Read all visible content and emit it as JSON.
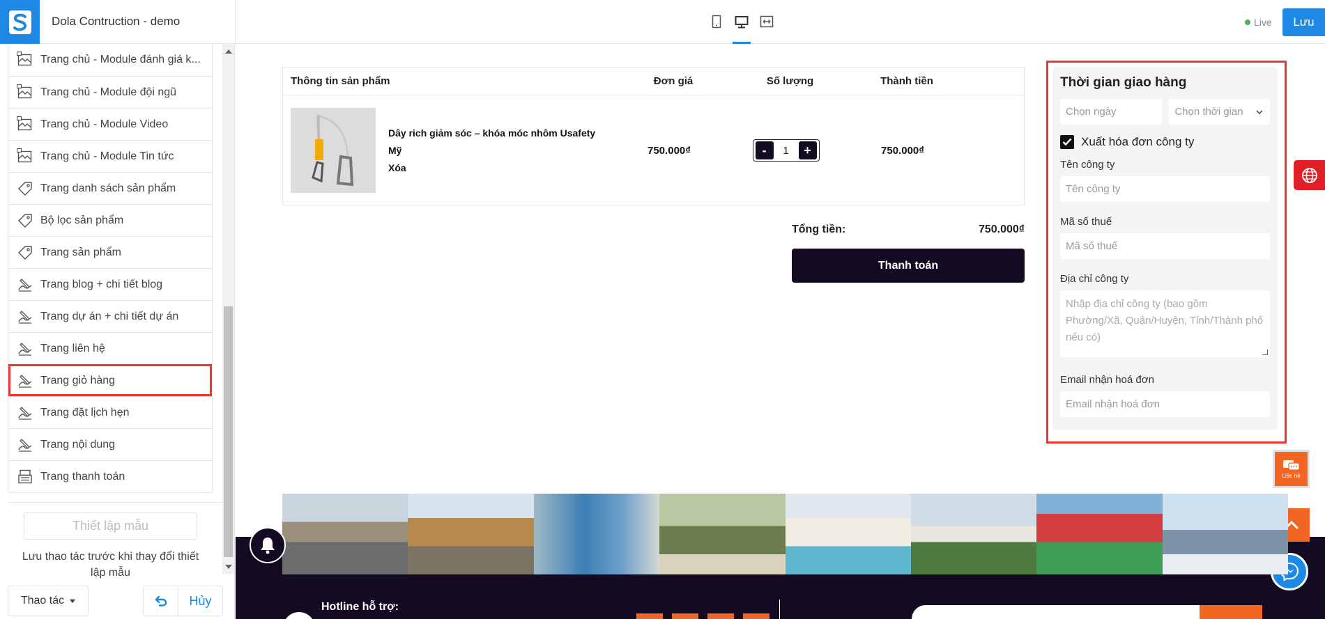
{
  "header": {
    "site_name": "Dola Contruction - demo",
    "live_label": "Live",
    "save_label": "Lưu",
    "brand_color": "#1e88e5"
  },
  "sidebar": {
    "items": [
      {
        "label": "Trang chủ - Module đánh giá k...",
        "icon": "layout-icon"
      },
      {
        "label": "Trang chủ - Module đội ngũ",
        "icon": "layout-icon"
      },
      {
        "label": "Trang chủ - Module Video",
        "icon": "layout-icon"
      },
      {
        "label": "Trang chủ - Module Tin tức",
        "icon": "layout-icon"
      },
      {
        "label": "Trang danh sách sản phẩm",
        "icon": "tag-icon"
      },
      {
        "label": "Bộ lọc sản phẩm",
        "icon": "tag-icon"
      },
      {
        "label": "Trang sản phẩm",
        "icon": "tag-icon"
      },
      {
        "label": "Trang blog + chi tiết blog",
        "icon": "pen-icon"
      },
      {
        "label": "Trang dự án + chi tiết dự án",
        "icon": "pen-icon"
      },
      {
        "label": "Trang liên hệ",
        "icon": "pen-icon"
      },
      {
        "label": "Trang giỏ hàng",
        "icon": "pen-icon",
        "selected": true
      },
      {
        "label": "Trang đặt lịch hẹn",
        "icon": "pen-icon"
      },
      {
        "label": "Trang nội dung",
        "icon": "pen-icon"
      },
      {
        "label": "Trang thanh toán",
        "icon": "register-icon"
      }
    ],
    "template_button": "Thiết lập mẫu",
    "template_note": "Lưu thao tác trước khi thay đổi thiết lập mẫu",
    "action_label": "Thao tác",
    "cancel_label": "Hủy"
  },
  "cart": {
    "headers": {
      "info": "Thông tin sản phẩm",
      "price": "Đơn giá",
      "qty": "Số lượng",
      "total": "Thành tiền"
    },
    "item": {
      "name_line1": "Dây rich giảm sóc – khóa móc nhôm Usafety Mỹ",
      "name_line2": "Xóa",
      "price": "750.000₫",
      "qty": "1",
      "minus": "-",
      "plus": "+",
      "total": "750.000₫"
    },
    "sum_label": "Tổng tiền:",
    "sum_value": "750.000₫",
    "checkout_label": "Thanh toán"
  },
  "delivery": {
    "title": "Thời gian giao hàng",
    "date_placeholder": "Chọn ngày",
    "time_placeholder": "Chọn thời gian",
    "invoice_label": "Xuất hóa đơn công ty",
    "company_label": "Tên công ty",
    "company_placeholder": "Tên công ty",
    "tax_label": "Mã số thuế",
    "tax_placeholder": "Mã số thuế",
    "address_label": "Địa chỉ công ty",
    "address_placeholder": "Nhập địa chỉ công ty (bao gồm Phường/Xã, Quận/Huyện, Tỉnh/Thành phố nếu có)",
    "email_label": "Email nhận hoá đơn",
    "email_placeholder": "Email nhận hoá đơn"
  },
  "footer": {
    "hotline_label": "Hotline hỗ trợ:",
    "contact_label": "Liên hệ"
  }
}
